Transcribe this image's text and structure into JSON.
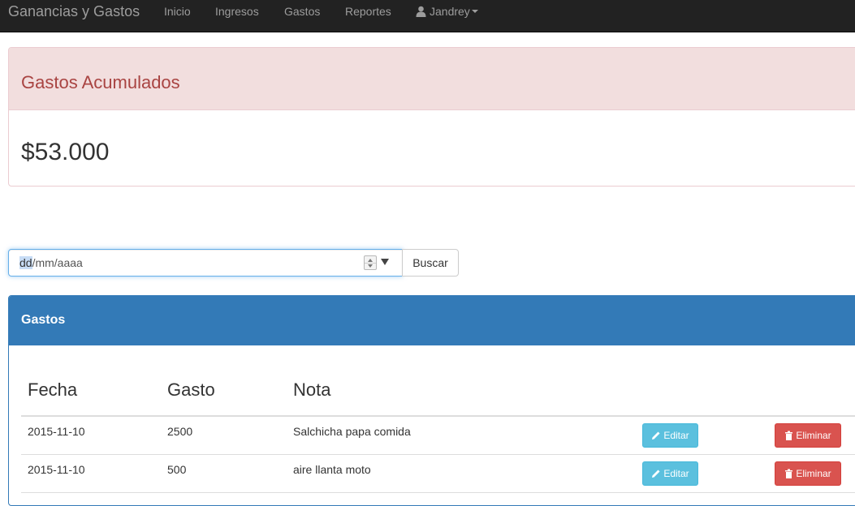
{
  "navbar": {
    "brand": "Ganancias y Gastos",
    "links": [
      "Inicio",
      "Ingresos",
      "Gastos",
      "Reportes"
    ],
    "user": "Jandrey",
    "icons": {
      "user": "user-icon",
      "caret": "caret-down-icon"
    }
  },
  "summary": {
    "title": "Gastos Acumulados",
    "amount": "$53.000"
  },
  "search": {
    "date_placeholder_selected": "dd",
    "date_placeholder_rest": "/mm/aaaa",
    "button_label": "Buscar"
  },
  "table": {
    "panel_title": "Gastos",
    "headers": [
      "Fecha",
      "Gasto",
      "Nota"
    ],
    "rows": [
      {
        "fecha": "2015-11-10",
        "gasto": "2500",
        "nota": "Salchicha papa comida",
        "edit_label": "Editar",
        "delete_label": "Eliminar"
      },
      {
        "fecha": "2015-11-10",
        "gasto": "500",
        "nota": "aire llanta moto",
        "edit_label": "Editar",
        "delete_label": "Eliminar"
      }
    ]
  },
  "colors": {
    "navbar": "#222222",
    "danger_heading_bg": "#f2dede",
    "danger_text": "#a94442",
    "primary": "#337ab7",
    "info_button": "#5bc0de",
    "danger_button": "#d9534f"
  }
}
